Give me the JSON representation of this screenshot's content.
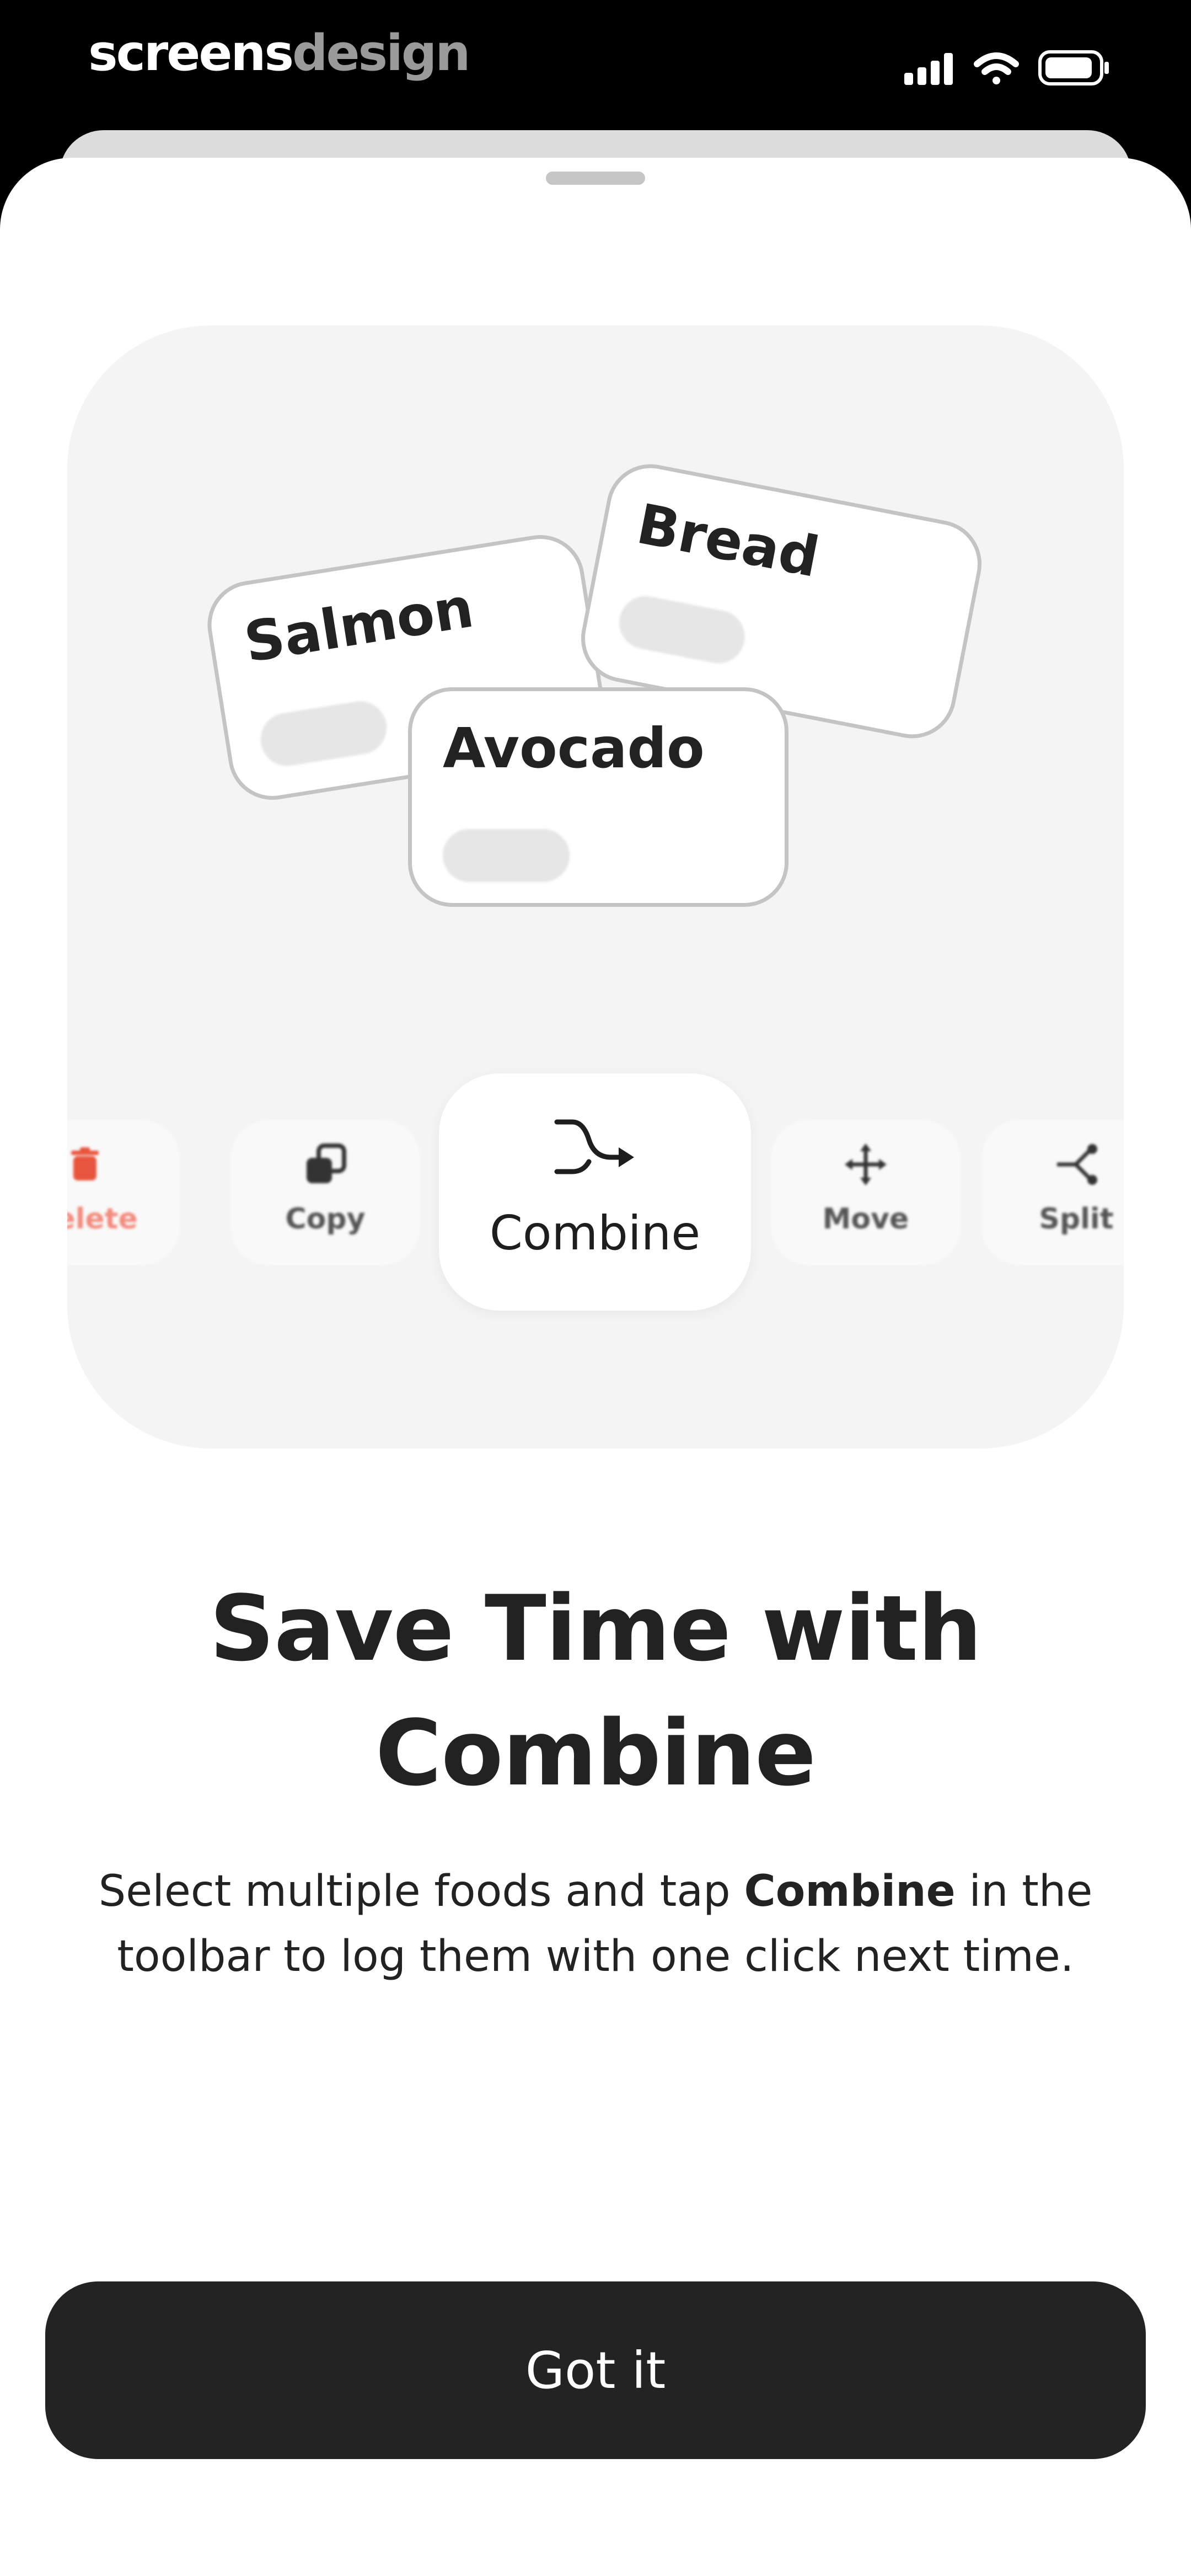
{
  "status_bar": {
    "brand_part1": "screens",
    "brand_part2": "design",
    "icons": [
      "cellular-signal-icon",
      "wifi-icon",
      "battery-icon"
    ]
  },
  "illustration": {
    "food_cards": [
      {
        "name": "Salmon"
      },
      {
        "name": "Bread"
      },
      {
        "name": "Avocado"
      }
    ],
    "toolbar": [
      {
        "label": "Delete",
        "icon": "trash-icon",
        "color": "#e8553f"
      },
      {
        "label": "Copy",
        "icon": "copy-icon"
      },
      {
        "label": "Combine",
        "icon": "merge-icon",
        "highlighted": true
      },
      {
        "label": "Move",
        "icon": "move-icon"
      },
      {
        "label": "Split",
        "icon": "split-icon"
      }
    ]
  },
  "content": {
    "title_line1": "Save Time with",
    "title_line2": "Combine",
    "desc_before": "Select multiple foods and tap ",
    "desc_bold": "Combine",
    "desc_after": " in the toolbar to log them with one click next time."
  },
  "actions": {
    "primary_label": "Got it"
  },
  "colors": {
    "background": "#000000",
    "sheet": "#ffffff",
    "panel": "#f4f4f5",
    "button": "#232323",
    "delete_accent": "#e8553f"
  }
}
